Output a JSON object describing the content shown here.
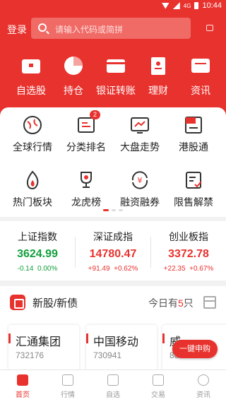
{
  "status_bar": {
    "time": "10:44",
    "network": "4G"
  },
  "header": {
    "login_label": "登录",
    "search_placeholder": "请输入代码或简拼"
  },
  "quick_actions": [
    {
      "label": "自选股",
      "icon": "folder-icon"
    },
    {
      "label": "持仓",
      "icon": "pie-chart-icon"
    },
    {
      "label": "银证转账",
      "icon": "card-icon"
    },
    {
      "label": "理财",
      "icon": "document-icon"
    },
    {
      "label": "资讯",
      "icon": "screen-icon"
    }
  ],
  "grid_menu": [
    {
      "label": "全球行情",
      "icon": "globe-icon"
    },
    {
      "label": "分类排名",
      "icon": "ranking-icon",
      "badge": "2"
    },
    {
      "label": "大盘走势",
      "icon": "trend-icon"
    },
    {
      "label": "港股通",
      "icon": "hk-icon"
    },
    {
      "label": "热门板块",
      "icon": "fire-icon"
    },
    {
      "label": "龙虎榜",
      "icon": "trophy-icon"
    },
    {
      "label": "融资融券",
      "icon": "yen-exchange-icon"
    },
    {
      "label": "限售解禁",
      "icon": "unlock-icon"
    }
  ],
  "indices": [
    {
      "name": "上证指数",
      "value": "3624.99",
      "change": "-0.14",
      "pct": "0.00%",
      "trend": "down"
    },
    {
      "name": "深证成指",
      "value": "14780.47",
      "change": "+91.49",
      "pct": "+0.62%",
      "trend": "up"
    },
    {
      "name": "创业板指",
      "value": "3372.78",
      "change": "+22.35",
      "pct": "+0.67%",
      "trend": "up"
    }
  ],
  "ipo": {
    "title": "新股/新债",
    "today_prefix": "今日有",
    "today_count": "5",
    "today_suffix": "只",
    "cards": [
      {
        "name": "汇通集团",
        "code": "732176"
      },
      {
        "name": "中国移动",
        "code": "730941"
      },
      {
        "name": "威",
        "code": "88"
      }
    ],
    "fab_label": "一键申购"
  },
  "tabbar": [
    {
      "label": "首页",
      "active": true
    },
    {
      "label": "行情"
    },
    {
      "label": "自选"
    },
    {
      "label": "交易"
    },
    {
      "label": "资讯"
    }
  ],
  "colors": {
    "brand_red": "#e8322e",
    "up": "#e8322e",
    "down": "#12a03c"
  }
}
